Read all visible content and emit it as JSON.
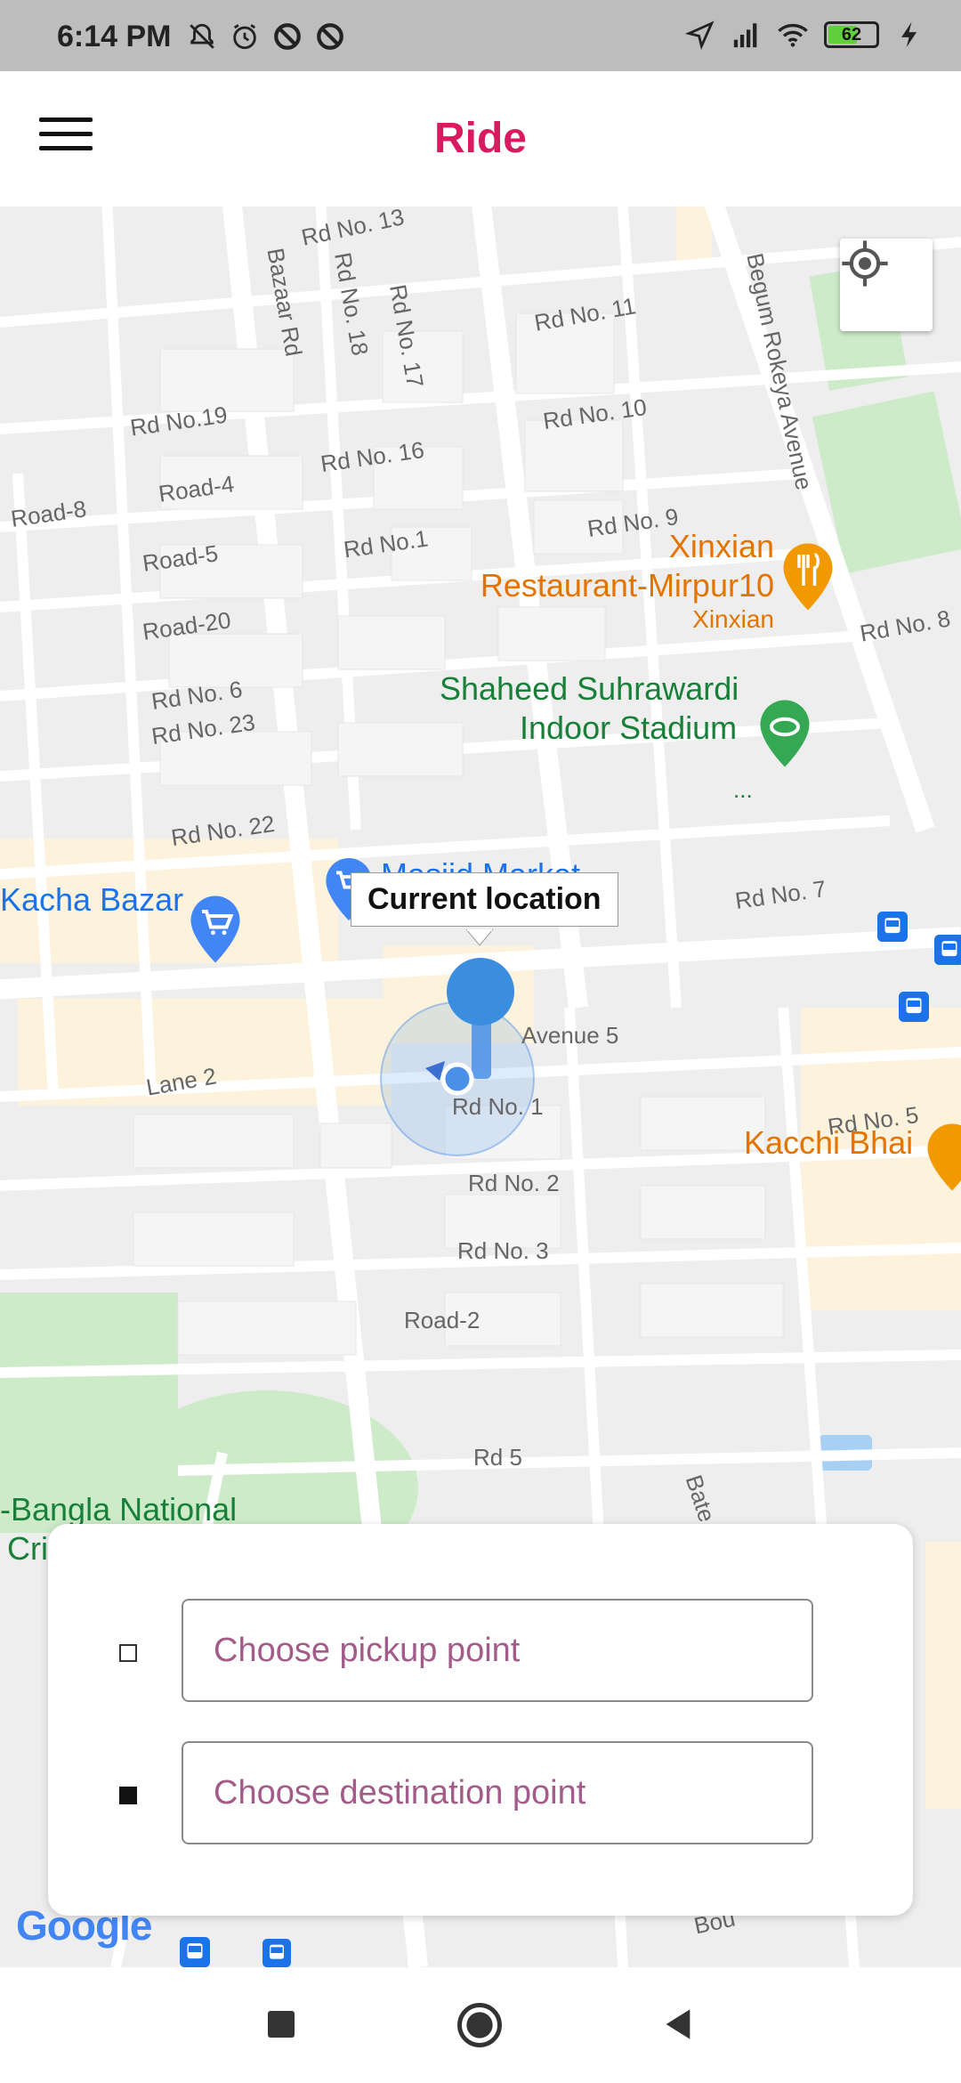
{
  "status": {
    "time": "6:14 PM",
    "battery": "62",
    "battery_level_percent": 62,
    "left_icons": [
      "muted-bell-icon",
      "alarm-icon",
      "blocked-icon",
      "blocked-icon"
    ],
    "right_icons": [
      "location-arrow-icon",
      "signal-icon",
      "wifi-icon",
      "battery-icon",
      "charging-icon"
    ]
  },
  "appbar": {
    "title": "Ride",
    "title_color": "#d81b60"
  },
  "map": {
    "street_labels": [
      "Rd No. 13",
      "Bazaar Rd",
      "Rd No. 18",
      "Rd No. 17",
      "Rd No. 11",
      "Begum Rokeya Avenue",
      "Rd No.19",
      "Rd No. 16",
      "Rd No. 10",
      "Road-4",
      "Road-8",
      "Road-5",
      "Rd No.1",
      "Rd No. 9",
      "Road-20",
      "Rd No. 8",
      "Rd No. 6",
      "Rd No. 23",
      "Rd No. 22",
      "Rd No. 7",
      "Avenue 5",
      "Lane 2",
      "Rd No. 1",
      "Rd No. 5",
      "Rd No. 2",
      "Rd No. 3",
      "Road-2",
      "Rd 5",
      "Bate",
      "Bou"
    ],
    "pois": {
      "restaurant_1_line1": "Xinxian",
      "restaurant_1_line2": "Restaurant-Mirpur10",
      "restaurant_1_sub": "Xinxian",
      "stadium_line1": "Shaheed Suhrawardi",
      "stadium_line2": "Indoor Stadium",
      "stadium_sub": "...",
      "market_left": "Kacha Bazar",
      "market_mid": "Masjid Market",
      "restaurant_2": "Kacchi Bhai",
      "stadium_2_line1": "-Bangla National",
      "stadium_2_line2": "Cri"
    },
    "callout": "Current location",
    "attribution": "Google"
  },
  "card": {
    "pickup_placeholder": "Choose pickup point",
    "destination_placeholder": "Choose destination point"
  },
  "navbar": {
    "buttons": [
      "recents-square-icon",
      "home-circle-icon",
      "back-triangle-icon"
    ]
  }
}
